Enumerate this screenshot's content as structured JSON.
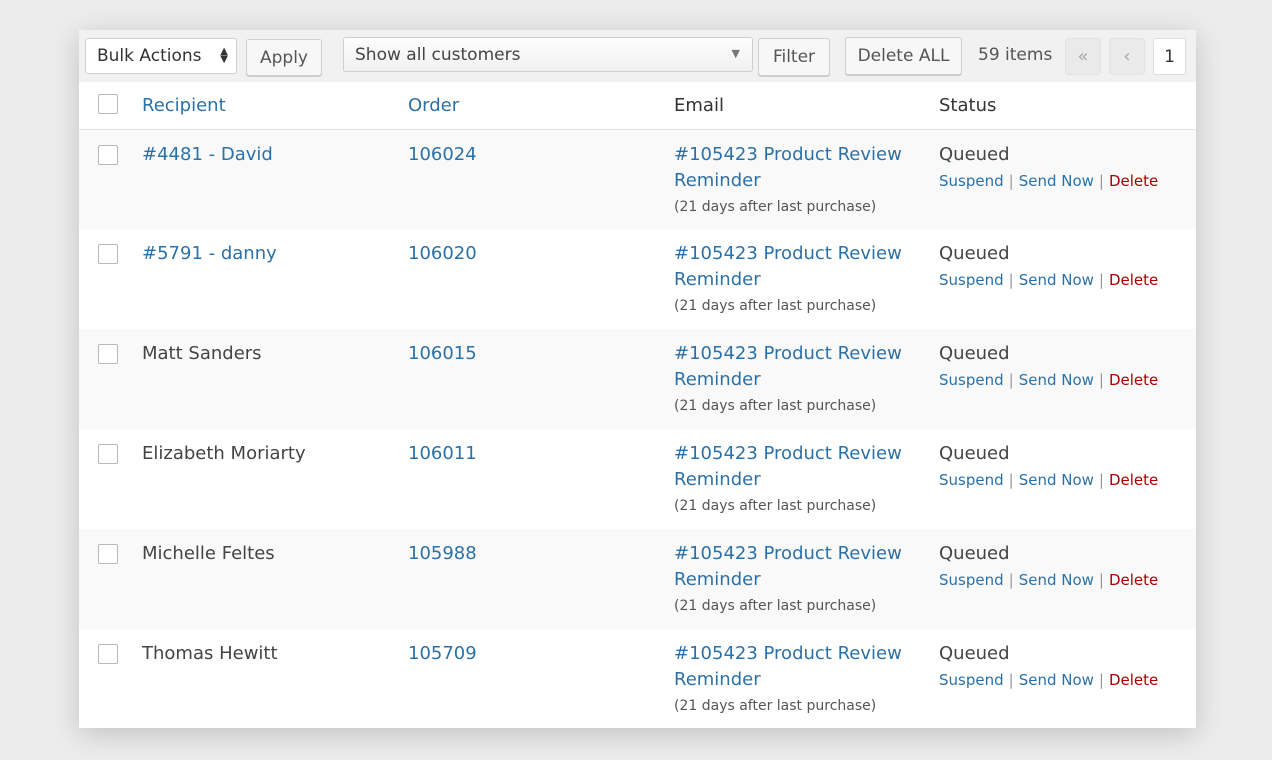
{
  "toolbar": {
    "bulk_actions": "Bulk Actions",
    "apply": "Apply",
    "customer_filter": "Show all customers",
    "filter": "Filter",
    "delete_all": "Delete ALL",
    "item_count": "59 items",
    "first_page": "«",
    "prev_page": "‹",
    "current_page": "1"
  },
  "table": {
    "headers": {
      "recipient": "Recipient",
      "order": "Order",
      "email": "Email",
      "status": "Status"
    },
    "rows": [
      {
        "recipient": "#4481 - David",
        "recipient_link": true,
        "order": "106024",
        "email": "#105423 Product Review Reminder",
        "email_line1": "#105423 Product Review",
        "email_line2": "Reminder",
        "schedule": "(21 days after last purchase)",
        "status": "Queued"
      },
      {
        "recipient": "#5791 - danny",
        "recipient_link": true,
        "order": "106020",
        "email": "#105423 Product Review Reminder",
        "email_line1": "#105423 Product Review",
        "email_line2": "Reminder",
        "schedule": "(21 days after last purchase)",
        "status": "Queued"
      },
      {
        "recipient": "Matt Sanders",
        "recipient_link": false,
        "order": "106015",
        "email_line1": "#105423 Product Review",
        "email_line2": "Reminder",
        "schedule": "(21 days after last purchase)",
        "status": "Queued"
      },
      {
        "recipient": "Elizabeth Moriarty",
        "recipient_link": false,
        "order": "106011",
        "email_line1": "#105423 Product Review",
        "email_line2": "Reminder",
        "schedule": "(21 days after last purchase)",
        "status": "Queued"
      },
      {
        "recipient": "Michelle Feltes",
        "recipient_link": false,
        "order": "105988",
        "email_line1": "#105423 Product Review",
        "email_line2": "Reminder",
        "schedule": "(21 days after last purchase)",
        "status": "Queued"
      },
      {
        "recipient": "Thomas Hewitt",
        "recipient_link": false,
        "order": "105709",
        "email_line1": "#105423 Product Review",
        "email_line2": "Reminder",
        "schedule": "(21 days after last purchase)",
        "status": "Queued"
      }
    ],
    "row_actions": {
      "suspend": "Suspend",
      "send_now": "Send Now",
      "delete": "Delete",
      "separator": "|"
    }
  },
  "colors": {
    "link": "#2b71a8",
    "delete": "#aa0000",
    "background": "#ececec"
  }
}
